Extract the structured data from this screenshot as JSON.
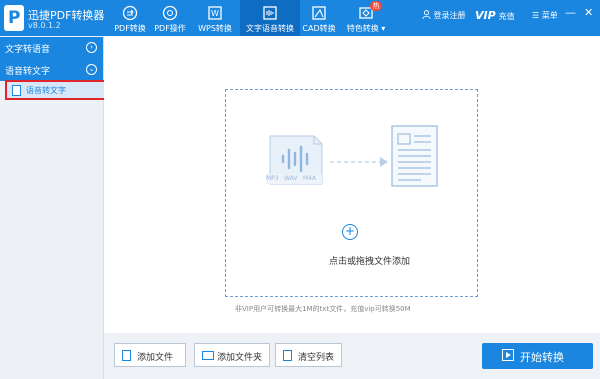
{
  "app": {
    "name": "迅捷PDF转换器",
    "version": "v8.0.1.2"
  },
  "nav": [
    {
      "label": "PDF转换",
      "icon": "pdf-convert-icon"
    },
    {
      "label": "PDF操作",
      "icon": "pdf-operation-icon"
    },
    {
      "label": "WPS转换",
      "icon": "wps-convert-icon"
    },
    {
      "label": "文字语音转换",
      "icon": "text-voice-convert-icon",
      "active": true
    },
    {
      "label": "CAD转换",
      "icon": "cad-convert-icon"
    },
    {
      "label": "特色转换",
      "icon": "special-convert-icon",
      "badge": "热"
    }
  ],
  "header_right": {
    "login": "登录注册",
    "vip": "VIP",
    "recharge": "充值",
    "menu": "菜单",
    "minimize": "—",
    "close": "✕"
  },
  "sidebar": {
    "sections": [
      {
        "label": "文字转语音",
        "chevron": "›",
        "expanded": false
      },
      {
        "label": "语音转文字",
        "chevron": "⌄",
        "expanded": true
      }
    ],
    "items": [
      {
        "label": "语音转文字",
        "selected": true
      }
    ]
  },
  "dropzone": {
    "formats": [
      "MP3",
      "WAV",
      "M4A"
    ],
    "plus": "+",
    "text": "点击或拖拽文件添加"
  },
  "hint": "非VIP用户可转换最大1M的txt文件，充值vip可转换50M",
  "buttons": {
    "add_file": "添加文件",
    "add_folder": "添加文件夹",
    "clear_list": "清空列表",
    "start": "开始转换"
  },
  "colors": {
    "primary": "#1a86e0",
    "highlight_border": "#e0262a",
    "badge": "#f24a35"
  }
}
